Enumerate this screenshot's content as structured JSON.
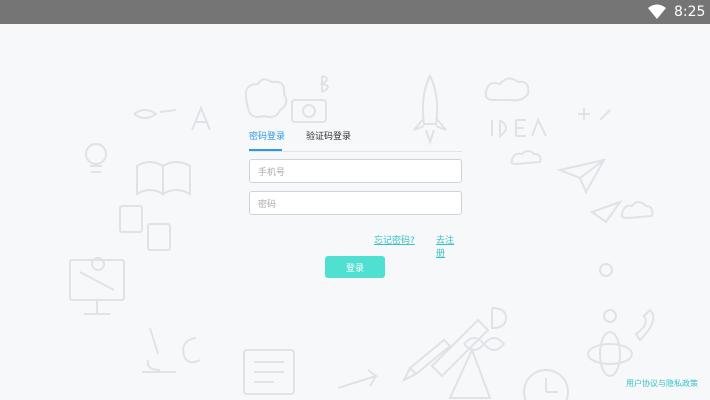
{
  "status_bar": {
    "time": "8:25",
    "wifi_icon": "wifi-icon"
  },
  "login": {
    "tabs": [
      {
        "label": "密码登录",
        "active": true
      },
      {
        "label": "验证码登录",
        "active": false
      }
    ],
    "phone_placeholder": "手机号",
    "password_placeholder": "密码",
    "forgot_password": "忘记密码?",
    "register": "去注册",
    "login_button": "登录"
  },
  "footer": {
    "agreement": "用户协议与隐私政策"
  },
  "colors": {
    "accent": "#2f98e6",
    "link": "#37c2c6",
    "button": "#4fe0d2",
    "status_bar": "#757575",
    "background": "#f7f8fa"
  }
}
